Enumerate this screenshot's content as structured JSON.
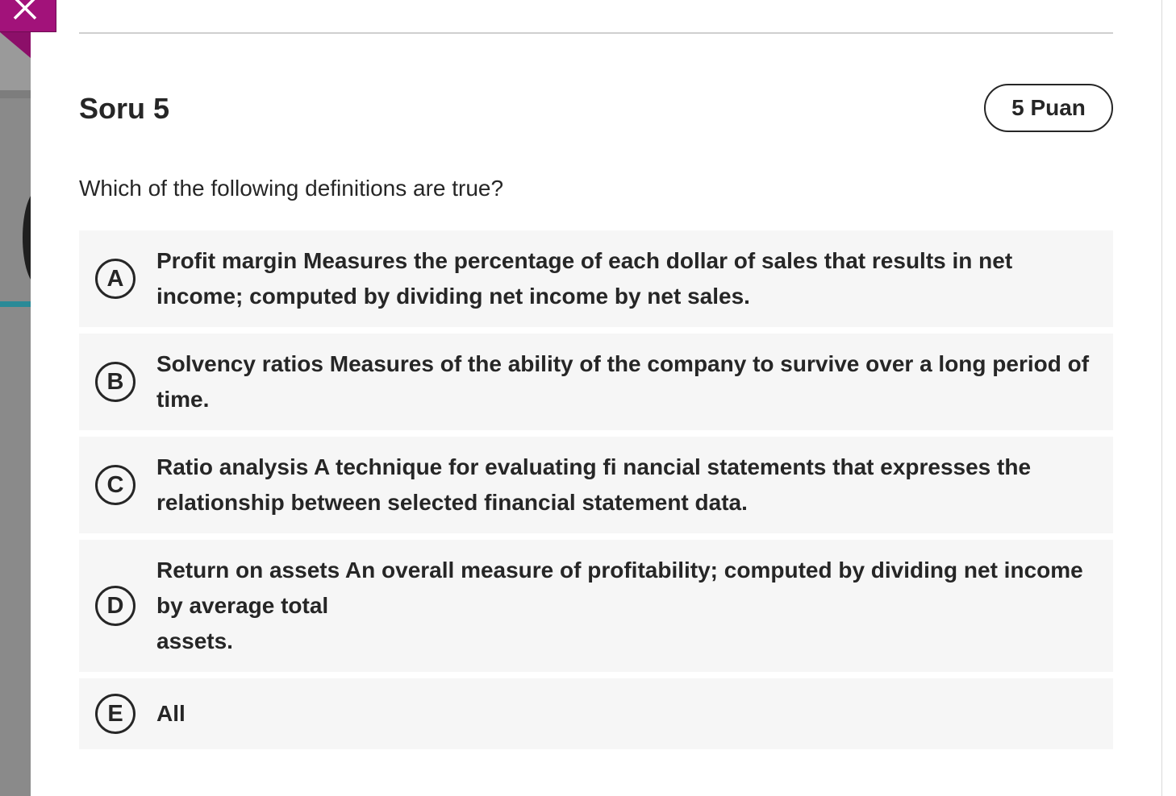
{
  "question": {
    "title": "Soru 5",
    "points": "5 Puan",
    "text": "Which of the following definitions are true?"
  },
  "options": [
    {
      "letter": "A",
      "text": "Profit margin Measures the percentage of each dollar of sales that results in net\nincome; computed by dividing net income by net sales."
    },
    {
      "letter": "B",
      "text": "Solvency ratios Measures of the ability of the company to survive over a long period of\ntime."
    },
    {
      "letter": "C",
      "text": "Ratio analysis A technique for evaluating fi nancial statements that expresses the\nrelationship between selected financial statement data."
    },
    {
      "letter": "D",
      "text": "Return on assets An overall measure of profitability; computed by dividing net income\nby average total\nassets."
    },
    {
      "letter": "E",
      "text": "All"
    }
  ],
  "colors": {
    "close_tab": "#a2127a",
    "option_background": "#f6f6f6",
    "text": "#262626",
    "accent": "#2a8a97"
  },
  "icons": {
    "close": "close-icon"
  }
}
